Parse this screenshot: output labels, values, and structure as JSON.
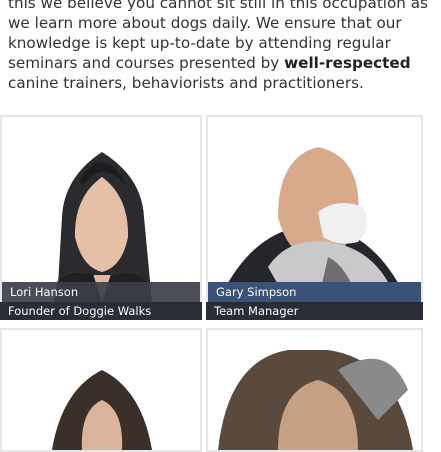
{
  "intro": {
    "top_partial": "but we believe you cannot sit still in this occupation as we",
    "p1": "this we believe you cannot sit still in this occupation as we learn more about dogs daily. We ensure that our knowledge is kept up-to-date by attending regular seminars and courses presented by",
    "bold": "well-respected",
    "p2": "canine trainers, behaviorists and practitioners."
  },
  "staff": [
    {
      "name": "Lori Hanson",
      "role": "Founder of Doggie Walks"
    },
    {
      "name": "Gary Simpson",
      "role": "Team Manager"
    }
  ],
  "colors": {
    "name_bar": "#3c3f4b",
    "role_bar": "#2b2d36"
  }
}
